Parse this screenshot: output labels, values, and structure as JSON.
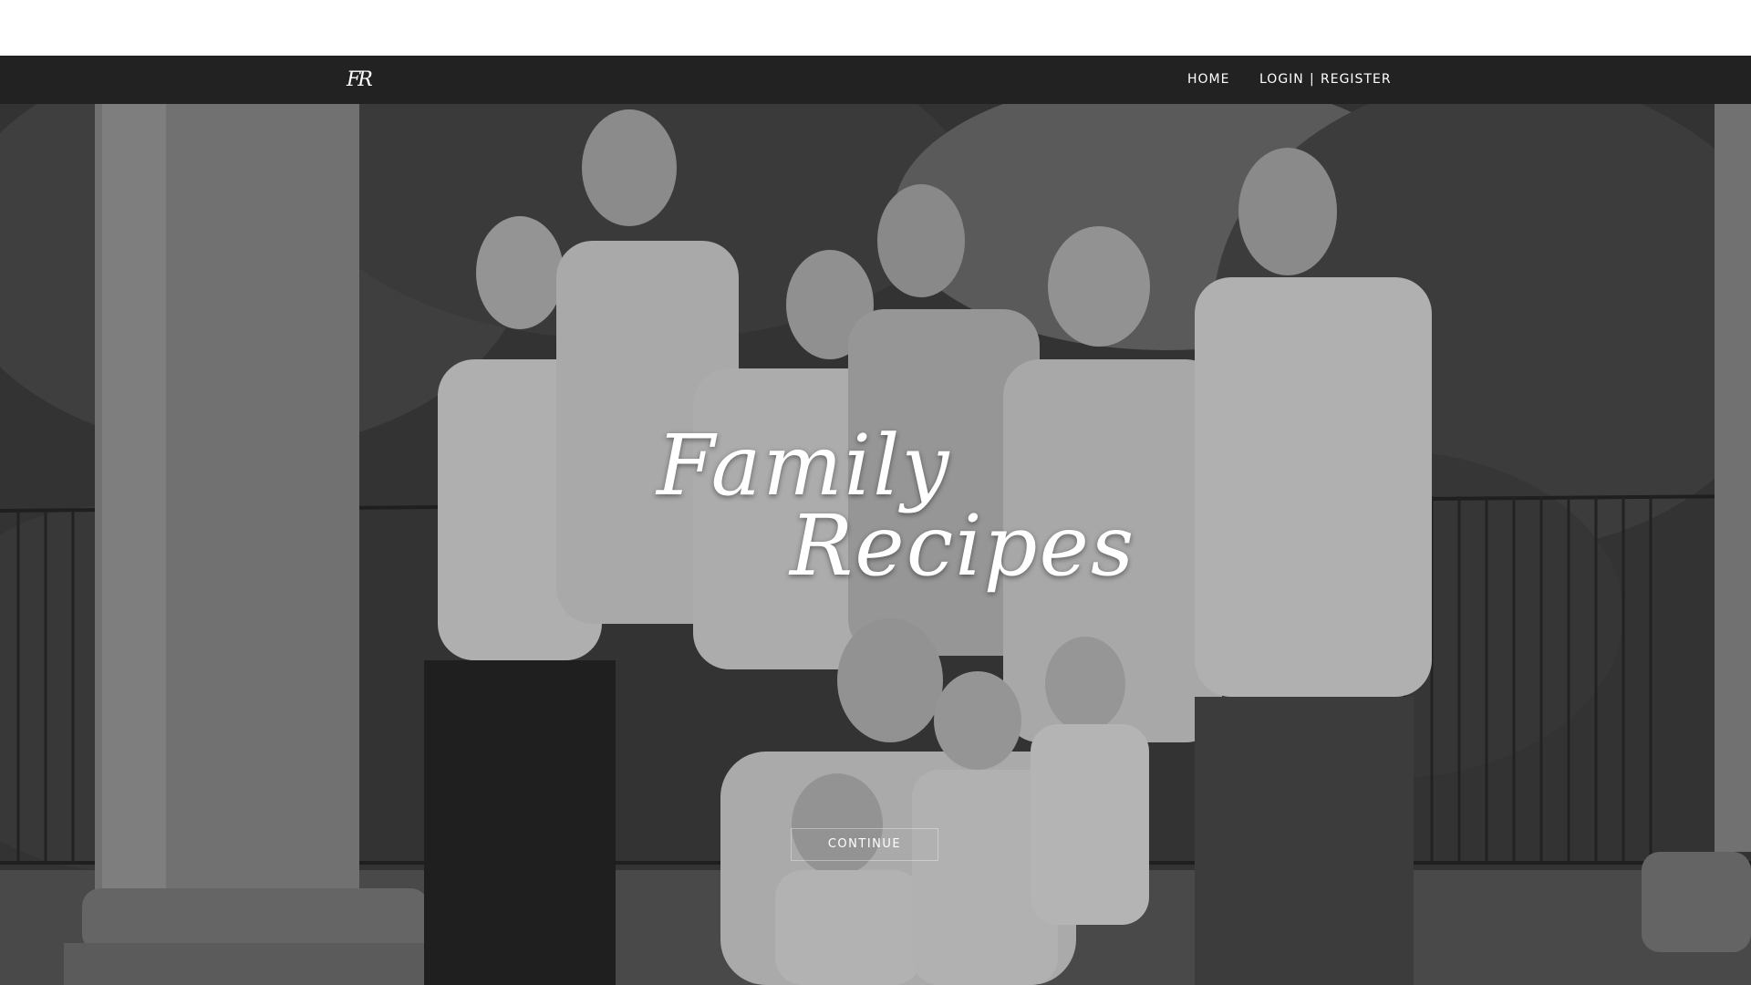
{
  "nav": {
    "brand_logo": "FR",
    "home_label": "HOME",
    "login_label": "LOGIN",
    "separator": "|",
    "register_label": "REGISTER"
  },
  "hero": {
    "title_word1": "Family",
    "title_word2": "Recipes",
    "continue_label": "CONTINUE",
    "image_description_icon": "family-photo-image"
  },
  "colors": {
    "navbar_bg": "#222222",
    "text": "#ffffff",
    "hero_overlay": "#3a3a3a"
  }
}
